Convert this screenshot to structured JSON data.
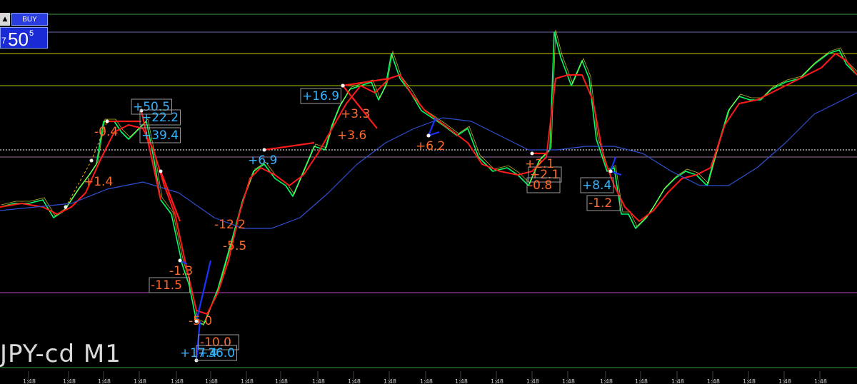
{
  "buy_panel": {
    "up_symbol": "▲",
    "button_label": "BUY",
    "price_prefix": "7",
    "price_main": "50",
    "price_sup": "5"
  },
  "symbol_label": "JPY-cd M1",
  "colors": {
    "background": "#000000",
    "price_line": "#00ff66",
    "price_line_alt": "#ffff33",
    "moving_average_fast": "#ff1a1a",
    "moving_average_slow": "#2f4fcf",
    "trade_buy": "#1a33ff",
    "label_positive": "#34b4ff",
    "label_negative": "#ff6a2a"
  },
  "chart_data": {
    "type": "line",
    "title": "",
    "xlabel": "",
    "ylabel": "",
    "horizontal_levels": [
      {
        "value": 100,
        "color": "#3b9e3b",
        "style": "solid"
      },
      {
        "value": 95,
        "color": "#6a6ab8",
        "style": "solid"
      },
      {
        "value": 89,
        "color": "#c8c800",
        "style": "solid"
      },
      {
        "value": 80,
        "color": "#a8c800",
        "style": "solid"
      },
      {
        "value": 62,
        "color": "#ffffff",
        "style": "dotted"
      },
      {
        "value": 60,
        "color": "#a070a0",
        "style": "solid"
      },
      {
        "value": 22,
        "color": "#c040c0",
        "style": "solid"
      },
      {
        "value": 1,
        "color": "#2fa02f",
        "style": "solid"
      }
    ],
    "ylim": [
      0,
      101
    ],
    "xlim": [
      0,
      1200
    ],
    "series": [
      {
        "values": [
          [
            0,
            46
          ],
          [
            20,
            47
          ],
          [
            40,
            47
          ],
          [
            60,
            48
          ],
          [
            75,
            43
          ],
          [
            90,
            45
          ],
          [
            110,
            51
          ],
          [
            125,
            55
          ],
          [
            135,
            58
          ],
          [
            145,
            70
          ],
          [
            160,
            70
          ],
          [
            170,
            67
          ],
          [
            180,
            65
          ],
          [
            195,
            68
          ],
          [
            205,
            70
          ],
          [
            215,
            60
          ],
          [
            225,
            48
          ],
          [
            240,
            44
          ],
          [
            255,
            30
          ],
          [
            265,
            24
          ],
          [
            275,
            14
          ],
          [
            285,
            13
          ],
          [
            295,
            18
          ],
          [
            305,
            23
          ],
          [
            315,
            30
          ],
          [
            325,
            37
          ],
          [
            340,
            48
          ],
          [
            355,
            56
          ],
          [
            370,
            58
          ],
          [
            385,
            54
          ],
          [
            400,
            52
          ],
          [
            410,
            49
          ],
          [
            425,
            56
          ],
          [
            440,
            63
          ],
          [
            455,
            62
          ],
          [
            465,
            69
          ],
          [
            475,
            74
          ],
          [
            490,
            79
          ],
          [
            505,
            80
          ],
          [
            520,
            81
          ],
          [
            530,
            76
          ],
          [
            540,
            80
          ],
          [
            548,
            89
          ],
          [
            560,
            82
          ],
          [
            575,
            78
          ],
          [
            590,
            73
          ],
          [
            605,
            71
          ],
          [
            620,
            69
          ],
          [
            640,
            66
          ],
          [
            655,
            68
          ],
          [
            670,
            60
          ],
          [
            690,
            56
          ],
          [
            710,
            57
          ],
          [
            725,
            55
          ],
          [
            740,
            52
          ],
          [
            755,
            59
          ],
          [
            770,
            62
          ],
          [
            776,
            95
          ],
          [
            785,
            88
          ],
          [
            800,
            80
          ],
          [
            815,
            87
          ],
          [
            825,
            82
          ],
          [
            835,
            65
          ],
          [
            850,
            56
          ],
          [
            860,
            57
          ],
          [
            870,
            44
          ],
          [
            880,
            44
          ],
          [
            890,
            40
          ],
          [
            905,
            43
          ],
          [
            915,
            46
          ],
          [
            930,
            51
          ],
          [
            945,
            54
          ],
          [
            960,
            56
          ],
          [
            975,
            55
          ],
          [
            990,
            52
          ],
          [
            1005,
            63
          ],
          [
            1020,
            73
          ],
          [
            1035,
            77
          ],
          [
            1050,
            76
          ],
          [
            1065,
            76
          ],
          [
            1080,
            79
          ],
          [
            1100,
            81
          ],
          [
            1120,
            82
          ],
          [
            1140,
            86
          ],
          [
            1160,
            89
          ],
          [
            1175,
            90
          ],
          [
            1185,
            86
          ],
          [
            1200,
            83
          ]
        ]
      },
      {
        "values": [
          [
            0,
            46
          ],
          [
            30,
            47
          ],
          [
            60,
            46
          ],
          [
            80,
            44
          ],
          [
            100,
            46
          ],
          [
            120,
            50
          ],
          [
            140,
            59
          ],
          [
            160,
            67
          ],
          [
            180,
            69
          ],
          [
            200,
            68
          ],
          [
            215,
            62
          ],
          [
            230,
            52
          ],
          [
            245,
            44
          ],
          [
            260,
            30
          ],
          [
            275,
            17
          ],
          [
            290,
            16
          ],
          [
            305,
            22
          ],
          [
            320,
            31
          ],
          [
            335,
            44
          ],
          [
            350,
            54
          ],
          [
            365,
            57
          ],
          [
            385,
            55
          ],
          [
            405,
            52
          ],
          [
            425,
            55
          ],
          [
            445,
            61
          ],
          [
            465,
            68
          ],
          [
            485,
            75
          ],
          [
            505,
            80
          ],
          [
            525,
            78
          ],
          [
            545,
            82
          ],
          [
            560,
            83
          ],
          [
            575,
            78
          ],
          [
            595,
            73
          ],
          [
            615,
            70
          ],
          [
            635,
            67
          ],
          [
            655,
            64
          ],
          [
            675,
            58
          ],
          [
            700,
            56
          ],
          [
            725,
            55
          ],
          [
            745,
            56
          ],
          [
            765,
            60
          ],
          [
            778,
            82
          ],
          [
            795,
            83
          ],
          [
            815,
            83
          ],
          [
            830,
            76
          ],
          [
            845,
            60
          ],
          [
            860,
            52
          ],
          [
            875,
            46
          ],
          [
            895,
            42
          ],
          [
            915,
            45
          ],
          [
            935,
            50
          ],
          [
            955,
            54
          ],
          [
            975,
            55
          ],
          [
            995,
            57
          ],
          [
            1015,
            69
          ],
          [
            1035,
            75
          ],
          [
            1060,
            76
          ],
          [
            1090,
            79
          ],
          [
            1120,
            82
          ],
          [
            1150,
            85
          ],
          [
            1170,
            89
          ],
          [
            1185,
            87
          ],
          [
            1200,
            83
          ]
        ]
      },
      {
        "values": [
          [
            0,
            45
          ],
          [
            50,
            46
          ],
          [
            100,
            47
          ],
          [
            150,
            51
          ],
          [
            200,
            53
          ],
          [
            250,
            50
          ],
          [
            300,
            43
          ],
          [
            340,
            40
          ],
          [
            380,
            40
          ],
          [
            420,
            43
          ],
          [
            460,
            50
          ],
          [
            500,
            58
          ],
          [
            540,
            64
          ],
          [
            580,
            68
          ],
          [
            620,
            71
          ],
          [
            660,
            70
          ],
          [
            700,
            66
          ],
          [
            740,
            62
          ],
          [
            780,
            62
          ],
          [
            820,
            63
          ],
          [
            860,
            63
          ],
          [
            900,
            61
          ],
          [
            940,
            56
          ],
          [
            980,
            52
          ],
          [
            1020,
            52
          ],
          [
            1060,
            57
          ],
          [
            1100,
            64
          ],
          [
            1140,
            72
          ],
          [
            1180,
            76
          ],
          [
            1200,
            78
          ]
        ]
      }
    ],
    "trades": [
      {
        "x1": 480,
        "y1": 80,
        "x2": 545,
        "y2": 82,
        "color": "#ff1a1a"
      },
      {
        "x1": 480,
        "y1": 80,
        "x2": 528,
        "y2": 68,
        "color": "#ff1a1a"
      },
      {
        "x1": 150,
        "y1": 70,
        "x2": 198,
        "y2": 70,
        "color": "#ff1a1a"
      },
      {
        "x1": 198,
        "y1": 73,
        "x2": 225,
        "y2": 48,
        "color": "#ff1a1a"
      },
      {
        "x1": 225,
        "y1": 56,
        "x2": 252,
        "y2": 42,
        "color": "#ff1a1a"
      },
      {
        "x1": 370,
        "y1": 62,
        "x2": 440,
        "y2": 64,
        "color": "#ff1a1a"
      },
      {
        "x1": 252,
        "y1": 31,
        "x2": 262,
        "y2": 30,
        "color": "#1a33ff"
      },
      {
        "x1": 275,
        "y1": 14,
        "x2": 295,
        "y2": 31,
        "color": "#1a33ff"
      },
      {
        "x1": 275,
        "y1": 3,
        "x2": 280,
        "y2": 14,
        "color": "#1a33ff"
      },
      {
        "x1": 600,
        "y1": 66,
        "x2": 615,
        "y2": 67,
        "color": "#1a33ff"
      },
      {
        "x1": 600,
        "y1": 66,
        "x2": 610,
        "y2": 71,
        "color": "#1a33ff"
      },
      {
        "x1": 855,
        "y1": 56,
        "x2": 870,
        "y2": 55,
        "color": "#1a33ff"
      },
      {
        "x1": 855,
        "y1": 56,
        "x2": 862,
        "y2": 60,
        "color": "#1a33ff"
      },
      {
        "x1": 745,
        "y1": 61,
        "x2": 765,
        "y2": 61,
        "color": "#ff1a1a"
      },
      {
        "x1": 128,
        "y1": 59,
        "x2": 150,
        "y2": 70,
        "color": "#ffaa00",
        "dashed": true
      },
      {
        "x1": 92,
        "y1": 46,
        "x2": 128,
        "y2": 59,
        "color": "#ffaa00",
        "dashed": true
      }
    ],
    "annotations": [
      {
        "text": "+50.5",
        "x": 184,
        "y": 74,
        "color": "#34b4ff",
        "boxed": true
      },
      {
        "text": "+22.2",
        "x": 196,
        "y": 71,
        "color": "#34b4ff",
        "boxed": true
      },
      {
        "text": "+39.4",
        "x": 196,
        "y": 66,
        "color": "#34b4ff",
        "boxed": true
      },
      {
        "text": "-0.4",
        "x": 130,
        "y": 67,
        "color": "#ff6a2a",
        "boxed": false
      },
      {
        "text": "+1.4",
        "x": 115,
        "y": 53,
        "color": "#ff6a2a",
        "boxed": false
      },
      {
        "text": "+16.9",
        "x": 421,
        "y": 77,
        "color": "#34b4ff",
        "boxed": true
      },
      {
        "text": "+3.3",
        "x": 475,
        "y": 72,
        "color": "#ff6a2a",
        "boxed": false
      },
      {
        "text": "+3.6",
        "x": 470,
        "y": 66,
        "color": "#ff6a2a",
        "boxed": false
      },
      {
        "text": "+6.9",
        "x": 345,
        "y": 59,
        "color": "#34b4ff",
        "boxed": false
      },
      {
        "text": "+6.2",
        "x": 580,
        "y": 63,
        "color": "#ff6a2a",
        "boxed": false
      },
      {
        "text": "-12.2",
        "x": 298,
        "y": 41,
        "color": "#ff6a2a",
        "boxed": false
      },
      {
        "text": "-5.5",
        "x": 310,
        "y": 35,
        "color": "#ff6a2a",
        "boxed": false
      },
      {
        "text": "-1.3",
        "x": 235,
        "y": 28,
        "color": "#ff6a2a",
        "boxed": false
      },
      {
        "text": "-11.5",
        "x": 209,
        "y": 24,
        "color": "#ff6a2a",
        "boxed": true
      },
      {
        "text": "-5.0",
        "x": 262,
        "y": 14,
        "color": "#ff6a2a",
        "boxed": false
      },
      {
        "text": "-10.0",
        "x": 278,
        "y": 8,
        "color": "#ff6a2a",
        "boxed": true
      },
      {
        "text": "+17.4",
        "x": 250,
        "y": 5,
        "color": "#34b4ff",
        "boxed": false
      },
      {
        "text": "+36.0",
        "x": 275,
        "y": 5,
        "color": "#34b4ff",
        "boxed": true
      },
      {
        "text": "+2.1",
        "x": 740,
        "y": 55,
        "color": "#ff6a2a",
        "boxed": true
      },
      {
        "text": "-0.8",
        "x": 738,
        "y": 52,
        "color": "#ff6a2a",
        "boxed": true
      },
      {
        "text": "+2.1",
        "x": 733,
        "y": 58,
        "color": "#ff6a2a",
        "boxed": false
      },
      {
        "text": "+8.4",
        "x": 813,
        "y": 52,
        "color": "#34b4ff",
        "boxed": true
      },
      {
        "text": "-1.2",
        "x": 822,
        "y": 47,
        "color": "#ff6a2a",
        "boxed": true
      }
    ],
    "x_tick_labels": [
      {
        "text": "1:48",
        "x": 40
      },
      {
        "text": "1:48",
        "x": 96
      },
      {
        "text": "1:48",
        "x": 145
      },
      {
        "text": "1:48",
        "x": 195
      },
      {
        "text": "1:48",
        "x": 247
      },
      {
        "text": "1:48",
        "x": 295
      },
      {
        "text": "1:48",
        "x": 345
      },
      {
        "text": "1:48",
        "x": 393
      },
      {
        "text": "1:48",
        "x": 445
      },
      {
        "text": "1:48",
        "x": 495
      },
      {
        "text": "1:48",
        "x": 545
      },
      {
        "text": "1:48",
        "x": 596
      },
      {
        "text": "1:48",
        "x": 645
      },
      {
        "text": "1:48",
        "x": 695
      },
      {
        "text": "1:48",
        "x": 745
      },
      {
        "text": "1:48",
        "x": 795
      },
      {
        "text": "1:48",
        "x": 848
      },
      {
        "text": "1:48",
        "x": 897
      },
      {
        "text": "1:48",
        "x": 948
      },
      {
        "text": "1:48",
        "x": 998
      },
      {
        "text": "1:48",
        "x": 1048
      },
      {
        "text": "1:48",
        "x": 1098
      },
      {
        "text": "1:48",
        "x": 1148
      }
    ],
    "grid": false
  }
}
